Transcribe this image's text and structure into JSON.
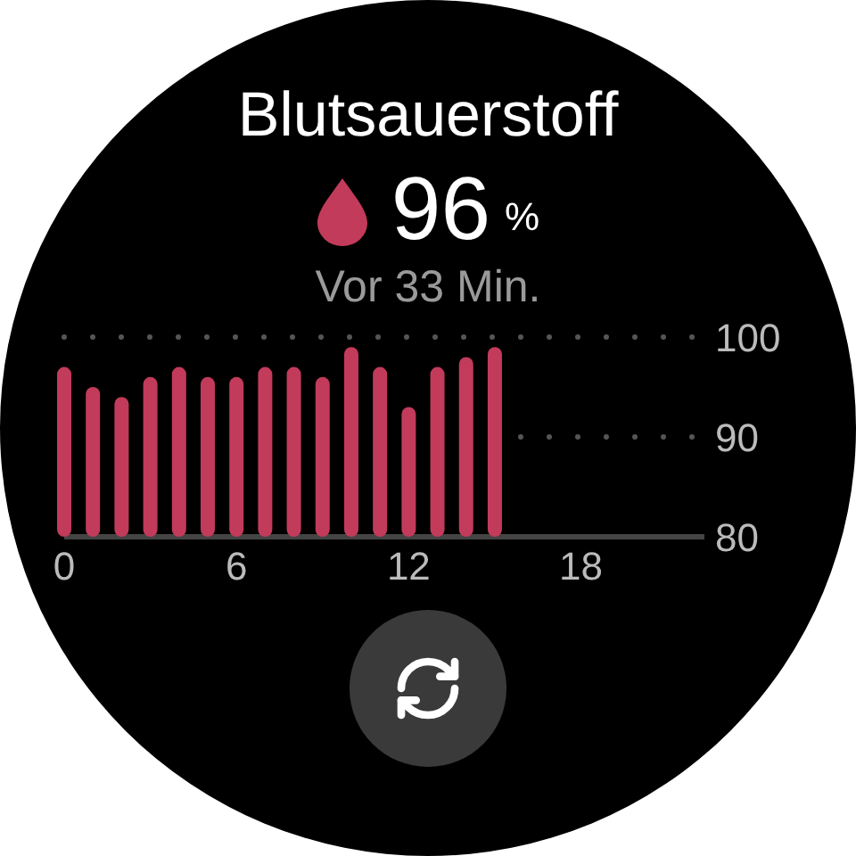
{
  "title": "Blutsauerstoff",
  "reading": {
    "value": "96",
    "unit": "%"
  },
  "last_measured": "Vor 33 Min.",
  "chart": {
    "chart_data": {
      "type": "bar",
      "x": [
        0,
        1,
        2,
        3,
        4,
        5,
        6,
        7,
        8,
        9,
        10,
        11,
        12,
        13,
        14,
        15
      ],
      "series": [
        {
          "color": "#c23b5a",
          "values": [
            97,
            95,
            94,
            96,
            97,
            96,
            96,
            97,
            97,
            96,
            99,
            97,
            93,
            97,
            98,
            99
          ]
        }
      ],
      "xlim": [
        0,
        22.3
      ],
      "ylim": [
        80,
        100
      ],
      "xticks": [
        0,
        6,
        12,
        18
      ],
      "yticks": [
        80,
        90,
        100
      ]
    }
  },
  "refresh_button": {
    "kind": "refresh"
  }
}
